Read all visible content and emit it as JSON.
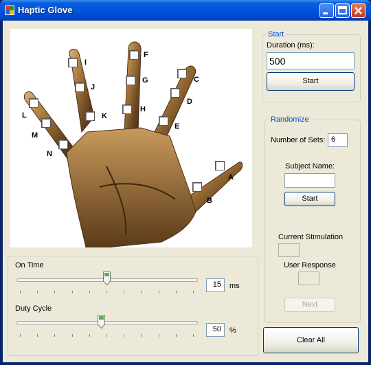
{
  "window": {
    "title": "Haptic Glove"
  },
  "hand": {
    "fingers": [
      {
        "id": "A",
        "label": "A"
      },
      {
        "id": "B",
        "label": "B"
      },
      {
        "id": "C",
        "label": "C"
      },
      {
        "id": "D",
        "label": "D"
      },
      {
        "id": "E",
        "label": "E"
      },
      {
        "id": "F",
        "label": "F"
      },
      {
        "id": "G",
        "label": "G"
      },
      {
        "id": "H",
        "label": "H"
      },
      {
        "id": "I",
        "label": "I"
      },
      {
        "id": "J",
        "label": "J"
      },
      {
        "id": "K",
        "label": "K"
      },
      {
        "id": "L",
        "label": "L"
      },
      {
        "id": "M",
        "label": "M"
      },
      {
        "id": "N",
        "label": "N"
      }
    ]
  },
  "sliders": {
    "on_time": {
      "label": "On Time",
      "value": "15",
      "unit": "ms",
      "level": 0.5
    },
    "duty_cycle": {
      "label": "Duty Cycle",
      "value": "50",
      "unit": "%",
      "level": 0.47
    }
  },
  "start_group": {
    "title": "Start",
    "duration_label": "Duration (ms):",
    "duration_value": "500",
    "start_button": "Start"
  },
  "randomize_group": {
    "title": "Randomize",
    "sets_label": "Number of Sets:",
    "sets_value": "6",
    "subject_label": "Subject Name:",
    "subject_value": "",
    "start_button": "Start",
    "current_label": "Current Stimulation",
    "response_label": "User Response",
    "next_button": "Next"
  },
  "clear_button": "Clear All",
  "colors": {
    "accent": "#0046d5",
    "title_bar": "#0053e0"
  }
}
